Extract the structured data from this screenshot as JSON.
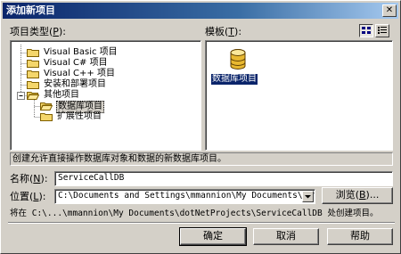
{
  "window": {
    "title": "添加新项目",
    "close_glyph": "✕"
  },
  "labels": {
    "project_types_label": "项目类型",
    "project_types_key": "P",
    "templates_label": "模板",
    "templates_key": "T"
  },
  "tree": [
    {
      "label": "Visual Basic 项目"
    },
    {
      "label": "Visual C# 项目"
    },
    {
      "label": "Visual C++ 项目"
    },
    {
      "label": "安装和部署项目"
    },
    {
      "label": "其他项目"
    },
    {
      "label": "数据库项目"
    },
    {
      "label": "扩展性项目"
    }
  ],
  "template": {
    "label": "数据库项目"
  },
  "description": "创建允许直接操作数据库对象和数据的新数据库项目。",
  "name": {
    "label": "名称",
    "key": "N",
    "value": "ServiceCallDB"
  },
  "location": {
    "label": "位置",
    "key": "L",
    "value": "C:\\Documents and Settings\\mmannion\\My Documents\\dotNet"
  },
  "browse": {
    "label": "浏览",
    "key": "B"
  },
  "create_path": "将在 C:\\...\\mmannion\\My Documents\\dotNetProjects\\ServiceCallDB 处创建项目。",
  "buttons": {
    "ok": "确定",
    "cancel": "取消",
    "help": "帮助"
  }
}
